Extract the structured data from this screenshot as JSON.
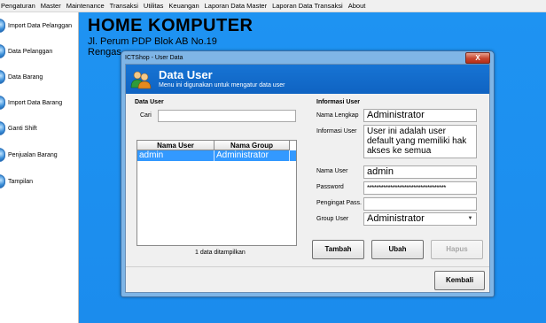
{
  "menu": [
    "Pengaturan",
    "Master",
    "Maintenance",
    "Transaksi",
    "Utilitas",
    "Keuangan",
    "Laporan Data Master",
    "Laporan Data Transaksi",
    "About"
  ],
  "sidebar": {
    "items": [
      {
        "label": "Import Data Pelanggan"
      },
      {
        "label": "Data Pelanggan"
      },
      {
        "label": "Data Barang"
      },
      {
        "label": "Import Data Barang"
      },
      {
        "label": "Ganti Shift"
      },
      {
        "label": "Penjualan Barang"
      },
      {
        "label": "Tampilan"
      }
    ]
  },
  "header": {
    "title": "HOME KOMPUTER",
    "address1": "Jl. Perum PDP Blok AB No.19",
    "address2": "Rengas"
  },
  "dialog": {
    "window_title": "ICTShop - User Data",
    "close": "X",
    "heading": "Data User",
    "subheading": "Menu ini digunakan untuk mengatur data user",
    "left": {
      "section_title": "Data User",
      "search_label": "Cari",
      "search_value": "",
      "columns": [
        "Nama User",
        "Nama Group"
      ],
      "rows": [
        [
          "admin",
          "Administrator"
        ]
      ],
      "status": "1 data ditampilkan"
    },
    "right": {
      "section_title": "Informasi User",
      "fields": {
        "nama_lengkap_label": "Nama Lengkap",
        "nama_lengkap_value": "Administrator",
        "informasi_label": "Informasi User",
        "informasi_value": "User ini adalah user default yang memiliki hak akses ke semua",
        "nama_user_label": "Nama User",
        "nama_user_value": "admin",
        "password_label": "Password",
        "password_value": "**********************************",
        "pengingat_label": "Pengingat Pass.",
        "pengingat_value": "",
        "group_label": "Group User",
        "group_value": "Administrator"
      }
    },
    "buttons": {
      "tambah": "Tambah",
      "ubah": "Ubah",
      "hapus": "Hapus",
      "kembali": "Kembali"
    }
  }
}
